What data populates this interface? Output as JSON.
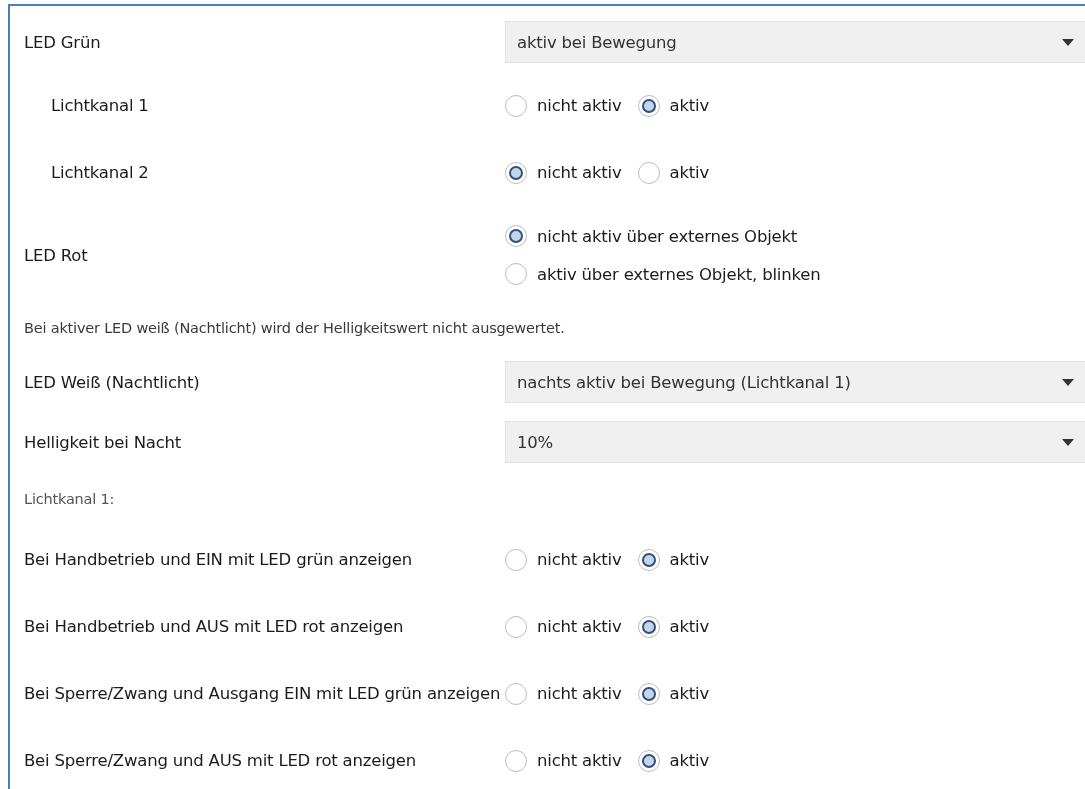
{
  "rows": [
    {
      "kind": "dropdown",
      "label": "LED Grün",
      "value": "aktiv bei Bewegung",
      "children": [
        {
          "kind": "radio",
          "label": "Lichtkanal 1",
          "options": [
            {
              "label": "nicht aktiv",
              "selected": false
            },
            {
              "label": "aktiv",
              "selected": true
            }
          ]
        },
        {
          "kind": "radio",
          "label": "Lichtkanal 2",
          "options": [
            {
              "label": "nicht aktiv",
              "selected": true
            },
            {
              "label": "aktiv",
              "selected": false
            }
          ]
        }
      ]
    },
    {
      "kind": "radio_stack",
      "label": "LED Rot",
      "options": [
        {
          "label": "nicht aktiv über externes Objekt",
          "selected": true
        },
        {
          "label": "aktiv über externes Objekt, blinken",
          "selected": false
        }
      ]
    },
    {
      "kind": "note",
      "label": "Bei aktiver LED weiß (Nachtlicht) wird der Helligkeitswert nicht ausgewertet."
    },
    {
      "kind": "dropdown",
      "label": "LED Weiß (Nachtlicht)",
      "value": "nachts aktiv bei Bewegung (Lichtkanal 1)"
    },
    {
      "kind": "dropdown",
      "label": "Helligkeit bei Nacht",
      "value": "10%"
    },
    {
      "kind": "heading",
      "label": "Lichtkanal 1:"
    },
    {
      "kind": "radio",
      "label": "Bei Handbetrieb und EIN mit LED grün anzeigen",
      "options": [
        {
          "label": "nicht aktiv",
          "selected": false
        },
        {
          "label": "aktiv",
          "selected": true
        }
      ]
    },
    {
      "kind": "radio",
      "label": "Bei Handbetrieb und AUS mit LED rot anzeigen",
      "options": [
        {
          "label": "nicht aktiv",
          "selected": false
        },
        {
          "label": "aktiv",
          "selected": true
        }
      ]
    },
    {
      "kind": "radio",
      "label": "Bei Sperre/Zwang und Ausgang EIN mit LED grün anzeigen",
      "options": [
        {
          "label": "nicht aktiv",
          "selected": false
        },
        {
          "label": "aktiv",
          "selected": true
        }
      ]
    },
    {
      "kind": "radio",
      "label": "Bei Sperre/Zwang und AUS mit LED rot anzeigen",
      "options": [
        {
          "label": "nicht aktiv",
          "selected": false
        },
        {
          "label": "aktiv",
          "selected": true
        }
      ]
    }
  ]
}
